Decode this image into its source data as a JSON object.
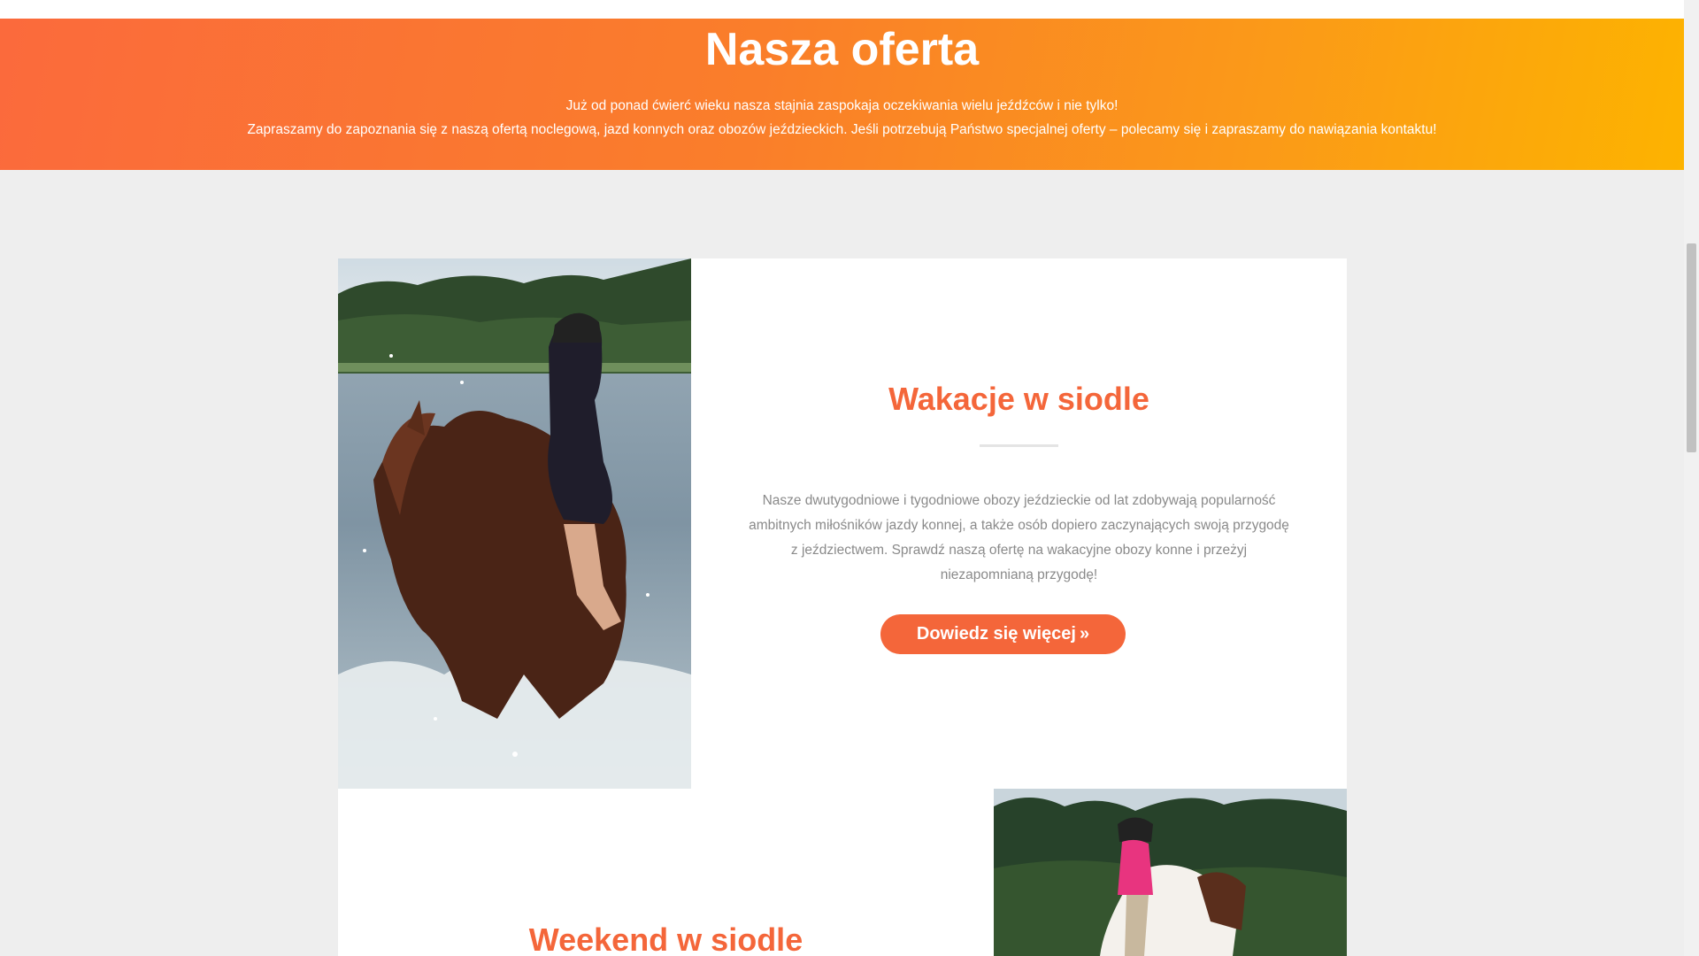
{
  "hero": {
    "title": "Nasza oferta",
    "line1": "Już od ponad ćwierć wieku nasza stajnia zaspokaja oczekiwania wielu jeźdźców i nie tylko!",
    "line2": "Zapraszamy do zapoznania się z naszą ofertą noclegową, jazd konnych oraz obozów jeździeckich. Jeśli potrzebują Państwo specjalnej oferty – polecamy się i zapraszamy do nawiązania kontaktu!"
  },
  "offers": [
    {
      "title": "Wakacje w siodle",
      "description": "Nasze dwutygodniowe i tygodniowe obozy jeździeckie od lat zdobywają popularność ambitnych miłośników jazdy konnej, a także osób dopiero zaczynających swoją przygodę z jeździectwem. Sprawdź naszą ofertę na wakacyjne obozy konne i przeżyj niezapomnianą przygodę!",
      "button_label": "Dowiedz się więcej",
      "button_icon": "»"
    },
    {
      "title": "Weekend w siodle"
    }
  ],
  "colors": {
    "accent": "#f4663a",
    "hero_gradient_start": "#fb6a3c",
    "hero_gradient_end": "#fdb300",
    "background": "#eeeeee"
  }
}
